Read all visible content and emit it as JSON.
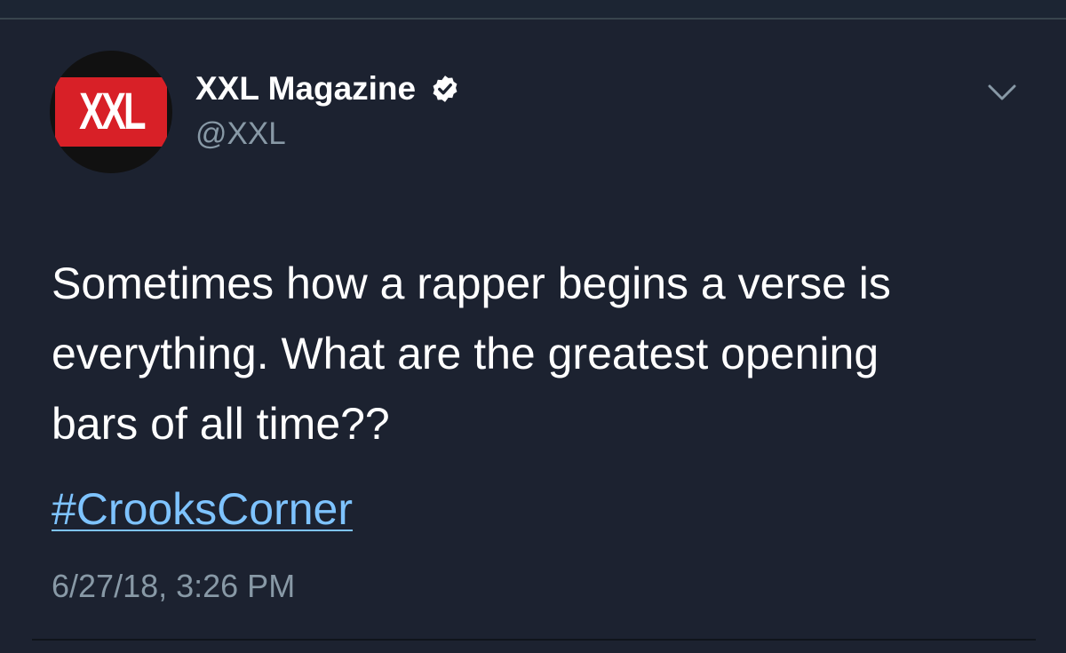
{
  "tweet": {
    "author": {
      "display_name": "XXL Magazine",
      "handle": "@XXL",
      "verified": true,
      "avatar_logo_text": "XXL"
    },
    "text_lines": [
      "Sometimes how a rapper begins a verse is",
      "everything. What are the greatest opening",
      "bars of all time??"
    ],
    "hashtag": "#CrooksCorner",
    "timestamp": "6/27/18, 3:26 PM",
    "menu_icon": "chevron-down-icon"
  },
  "colors": {
    "background": "#1c2230",
    "text_primary": "#ffffff",
    "text_secondary": "#8899a6",
    "link": "#7ec3ff",
    "logo_red": "#d82027"
  }
}
